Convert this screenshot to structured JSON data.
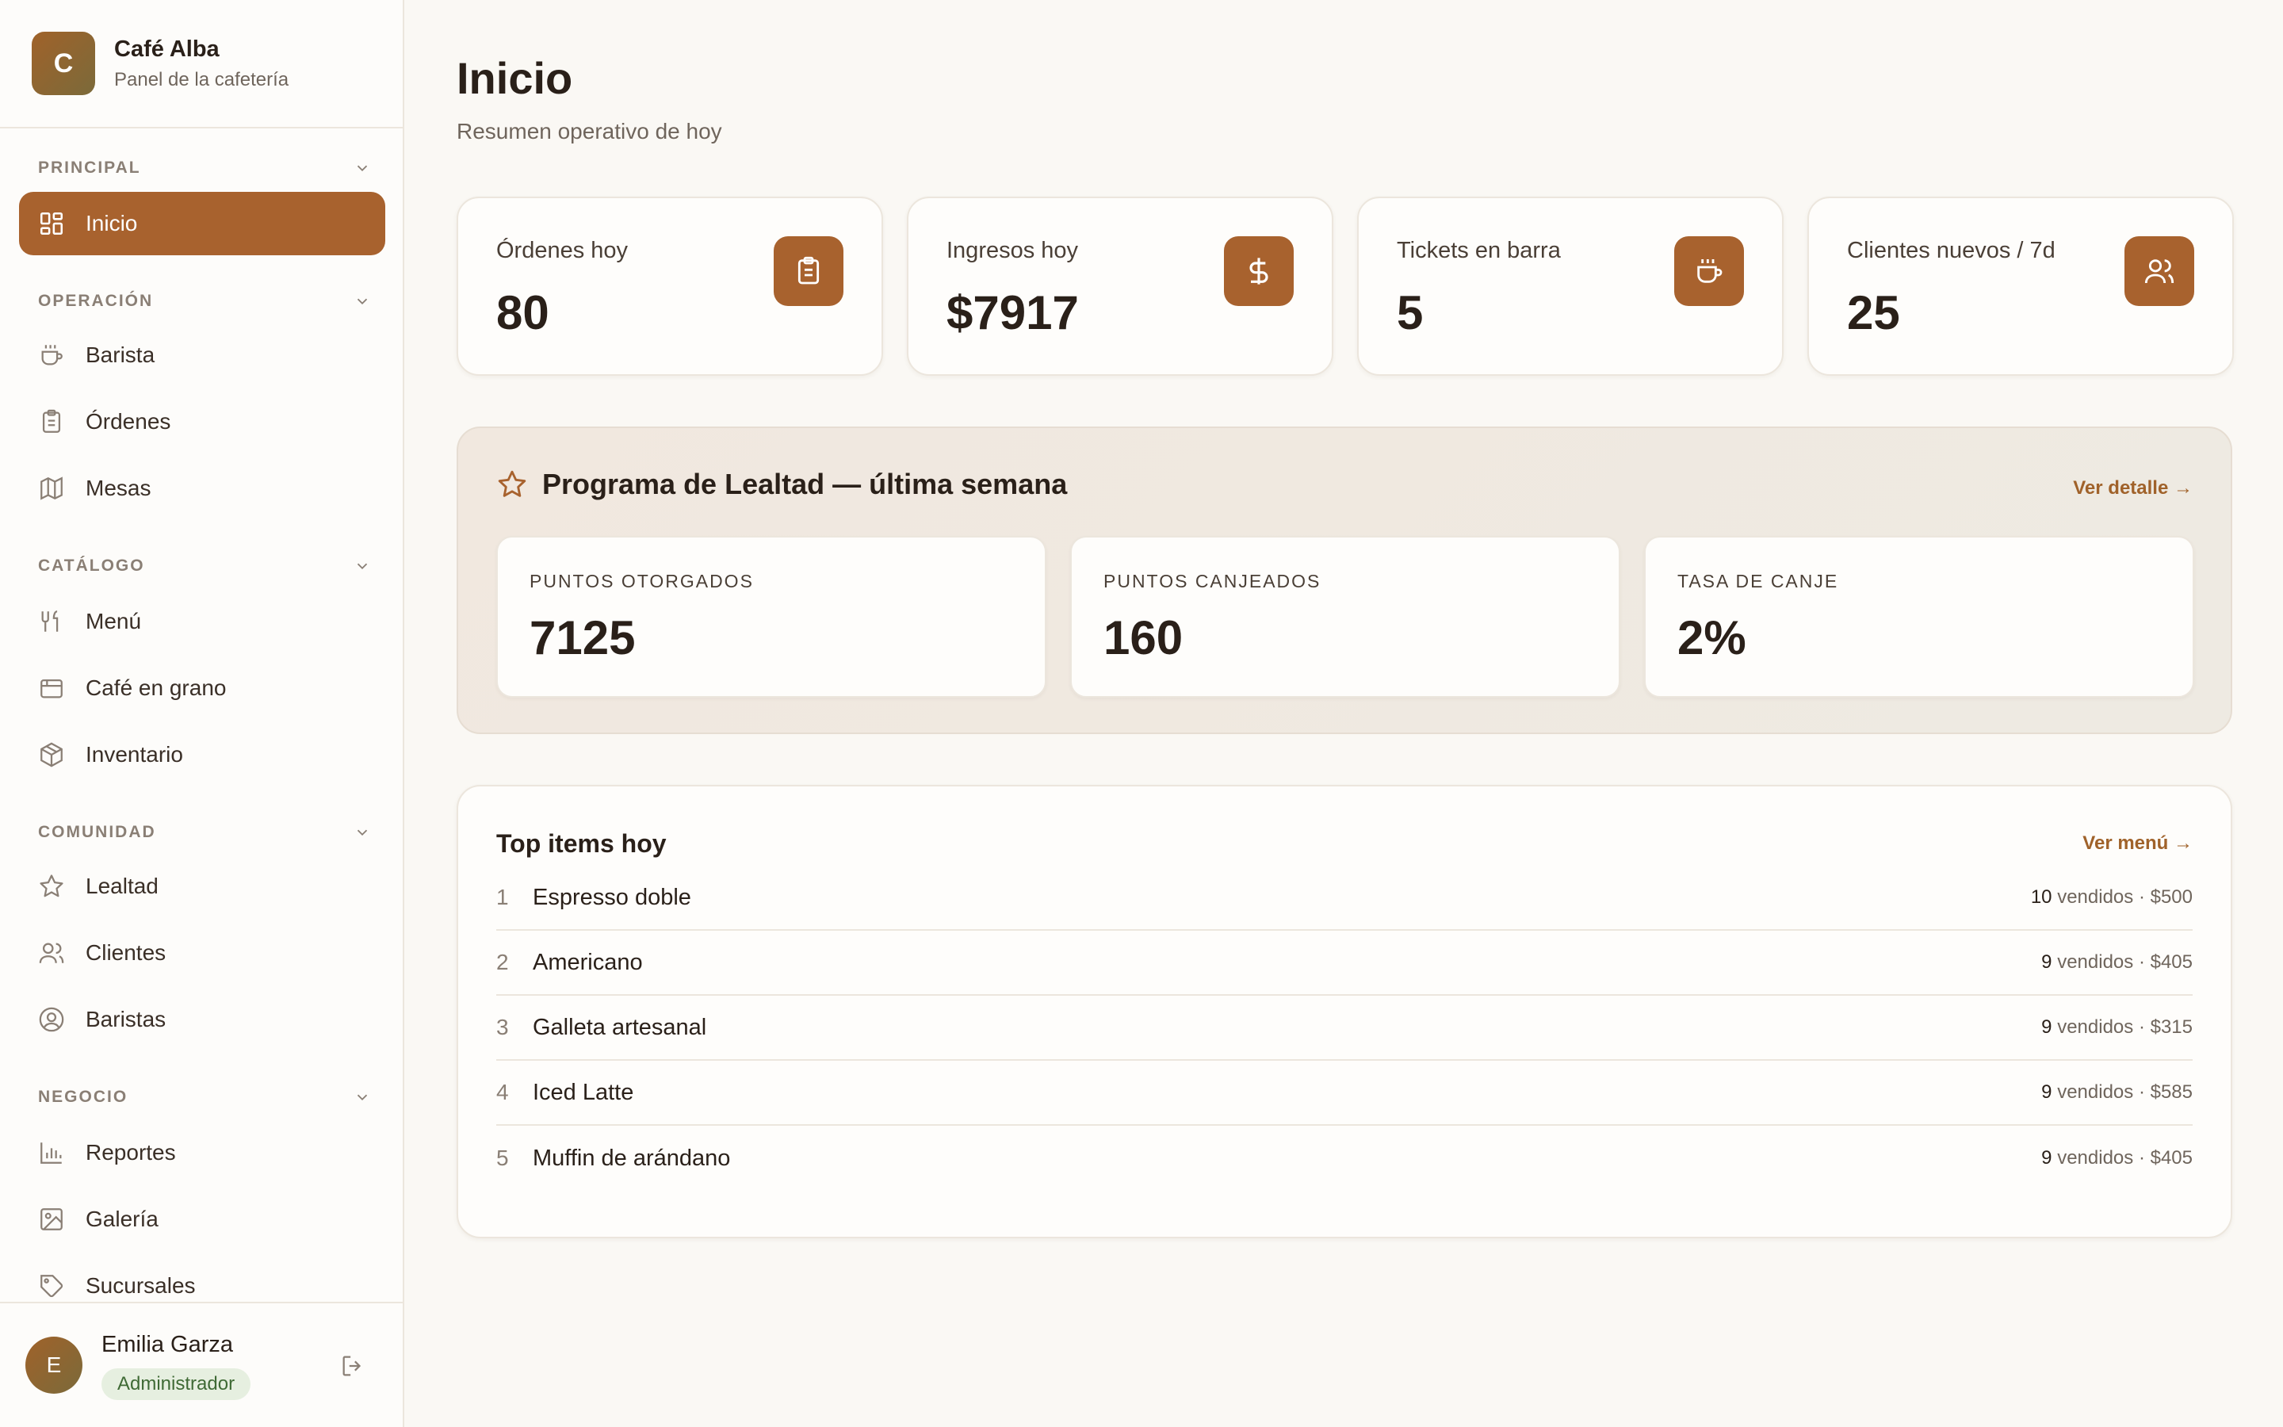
{
  "brand": {
    "logo_letter": "C",
    "name": "Café Alba",
    "subtitle": "Panel de la cafetería"
  },
  "sidebar": {
    "sections": [
      {
        "title": "PRINCIPAL",
        "items": [
          {
            "label": "Inicio",
            "icon": "dashboard-icon",
            "active": true
          }
        ]
      },
      {
        "title": "OPERACIÓN",
        "items": [
          {
            "label": "Barista",
            "icon": "coffee-cup-icon"
          },
          {
            "label": "Órdenes",
            "icon": "clipboard-icon"
          },
          {
            "label": "Mesas",
            "icon": "map-icon"
          }
        ]
      },
      {
        "title": "CATÁLOGO",
        "items": [
          {
            "label": "Menú",
            "icon": "utensils-icon"
          },
          {
            "label": "Café en grano",
            "icon": "package-icon"
          },
          {
            "label": "Inventario",
            "icon": "box-icon"
          }
        ]
      },
      {
        "title": "COMUNIDAD",
        "items": [
          {
            "label": "Lealtad",
            "icon": "star-icon"
          },
          {
            "label": "Clientes",
            "icon": "users-icon"
          },
          {
            "label": "Baristas",
            "icon": "user-circle-icon"
          }
        ]
      },
      {
        "title": "NEGOCIO",
        "items": [
          {
            "label": "Reportes",
            "icon": "bar-chart-icon"
          },
          {
            "label": "Galería",
            "icon": "image-icon"
          },
          {
            "label": "Sucursales",
            "icon": "tag-icon"
          }
        ]
      }
    ]
  },
  "user": {
    "initial": "E",
    "name": "Emilia Garza",
    "role": "Administrador"
  },
  "header": {
    "title": "Inicio",
    "subtitle": "Resumen operativo de hoy"
  },
  "stats": [
    {
      "label": "Órdenes hoy",
      "value": "80",
      "icon": "clipboard-icon"
    },
    {
      "label": "Ingresos hoy",
      "value": "$7917",
      "icon": "dollar-icon"
    },
    {
      "label": "Tickets en barra",
      "value": "5",
      "icon": "coffee-cup-icon"
    },
    {
      "label": "Clientes nuevos / 7d",
      "value": "25",
      "icon": "users-icon"
    }
  ],
  "loyalty": {
    "title": "Programa de Lealtad — última semana",
    "link": "Ver detalle →",
    "metrics": [
      {
        "label": "PUNTOS OTORGADOS",
        "value": "7125"
      },
      {
        "label": "PUNTOS CANJEADOS",
        "value": "160"
      },
      {
        "label": "TASA DE CANJE",
        "value": "2%"
      }
    ]
  },
  "top_items": {
    "title": "Top items hoy",
    "link": "Ver menú →",
    "sold_word": "vendidos",
    "rows": [
      {
        "rank": "1",
        "name": "Espresso doble",
        "qty": "10",
        "price": "$500"
      },
      {
        "rank": "2",
        "name": "Americano",
        "qty": "9",
        "price": "$405"
      },
      {
        "rank": "3",
        "name": "Galleta artesanal",
        "qty": "9",
        "price": "$315"
      },
      {
        "rank": "4",
        "name": "Iced Latte",
        "qty": "9",
        "price": "$585"
      },
      {
        "rank": "5",
        "name": "Muffin de arándano",
        "qty": "9",
        "price": "$405"
      }
    ]
  },
  "colors": {
    "accent": "#a8622e",
    "background": "#faf8f4",
    "card": "#fefdfb",
    "role_badge": "#e6efe0"
  }
}
